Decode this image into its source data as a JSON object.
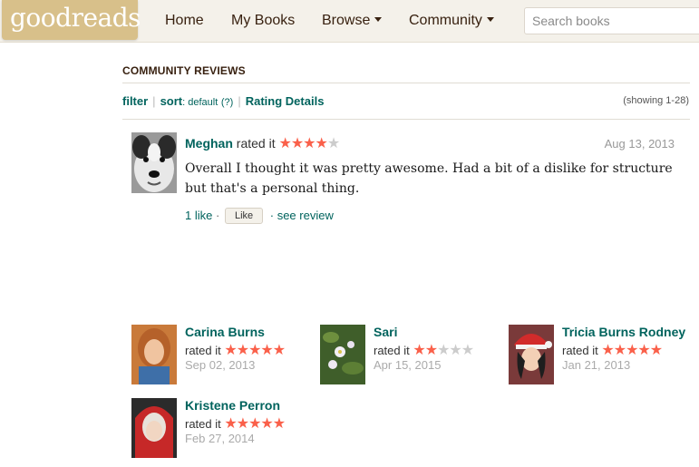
{
  "header": {
    "logo_text": "goodreads",
    "nav": {
      "home": "Home",
      "my_books": "My Books",
      "browse": "Browse",
      "community": "Community"
    },
    "search_placeholder": "Search books"
  },
  "reviews": {
    "section_title": "COMMUNITY REVIEWS",
    "filter_label": "filter",
    "sort_label": "sort",
    "sort_value": ": default",
    "sort_help": "(?)",
    "rating_details": "Rating Details",
    "showing": "(showing 1-28)",
    "items": [
      {
        "user": "Meghan",
        "rated_text": "rated it",
        "stars_on": "★★★★",
        "stars_off": "★",
        "rating": 4,
        "date": "Aug 13, 2013",
        "text": "Overall I thought it was pretty awesome. Had a bit of a dislike for structure but that's a personal thing.",
        "likes": "1 like",
        "dot": "·",
        "like_button": "Like",
        "see_review": "· see review"
      }
    ]
  },
  "raters": [
    {
      "name": "Carina Burns",
      "rated_text": "rated it",
      "stars_on": "★★★★★",
      "stars_off": "",
      "rating": 5,
      "date": "Sep 02, 2013"
    },
    {
      "name": "Sari",
      "rated_text": "rated it",
      "stars_on": "★★",
      "stars_off": "★★★",
      "rating": 2,
      "date": "Apr 15, 2015"
    },
    {
      "name": "Tricia Burns Rodney",
      "rated_text": "rated it",
      "stars_on": "★★★★★",
      "stars_off": "",
      "rating": 5,
      "date": "Jan 21, 2013"
    },
    {
      "name": "Kristene Perron",
      "rated_text": "rated it",
      "stars_on": "★★★★★",
      "stars_off": "",
      "rating": 5,
      "date": "Feb 27, 2014"
    }
  ],
  "colors": {
    "brand_link": "#00635d",
    "star": "#fa604a",
    "header_bg": "#f4f1ea",
    "logo_bg": "#d8c08a"
  }
}
